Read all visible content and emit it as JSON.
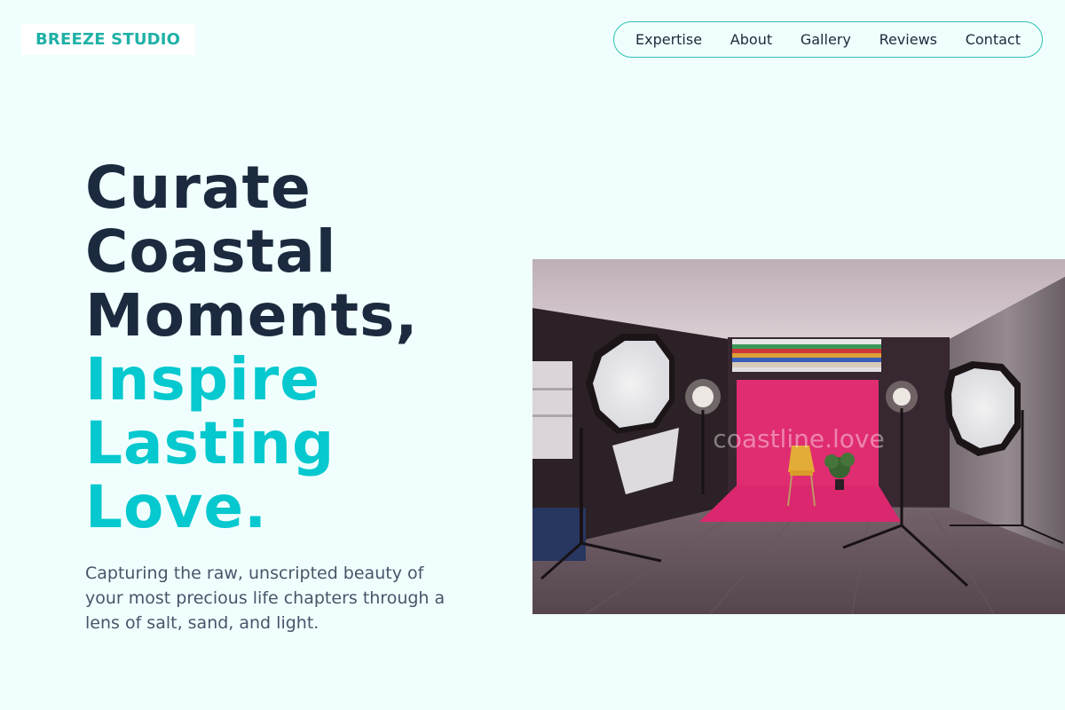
{
  "brand": {
    "name": "BREEZE STUDIO",
    "color": "#1fb1a6"
  },
  "nav": {
    "items": [
      {
        "label": "Expertise"
      },
      {
        "label": "About"
      },
      {
        "label": "Gallery"
      },
      {
        "label": "Reviews"
      },
      {
        "label": "Contact"
      }
    ],
    "border_color": "#2fc0b6"
  },
  "hero": {
    "title_lines_dark": [
      "Curate",
      "Coastal",
      "Moments,"
    ],
    "title_lines_accent": [
      "Inspire",
      "Lasting",
      "Love."
    ],
    "subtitle": "Capturing the raw, unscripted beauty of your most precious life chapters through a lens of salt, sand, and light.",
    "dark_color": "#1b2a3e",
    "accent_color": "#06c8cf"
  },
  "image": {
    "watermark": "coastline.love"
  }
}
